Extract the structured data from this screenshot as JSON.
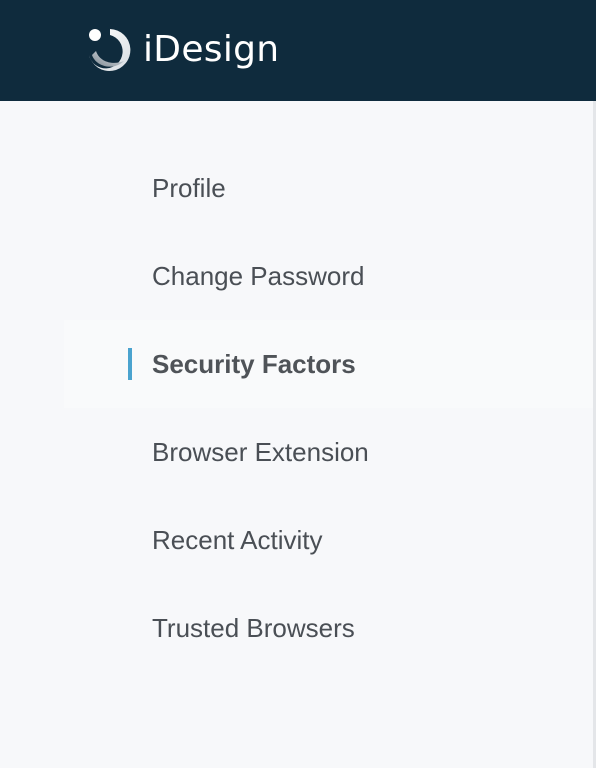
{
  "header": {
    "brand_name": "iDesign",
    "logo_icon": "idesign-logo-icon",
    "background_color": "#0f2b3d"
  },
  "sidebar": {
    "active_index": 2,
    "accent_color": "#4aa3cf",
    "items": [
      {
        "label": "Profile"
      },
      {
        "label": "Change Password"
      },
      {
        "label": "Security Factors"
      },
      {
        "label": "Browser Extension"
      },
      {
        "label": "Recent Activity"
      },
      {
        "label": "Trusted Browsers"
      }
    ]
  }
}
